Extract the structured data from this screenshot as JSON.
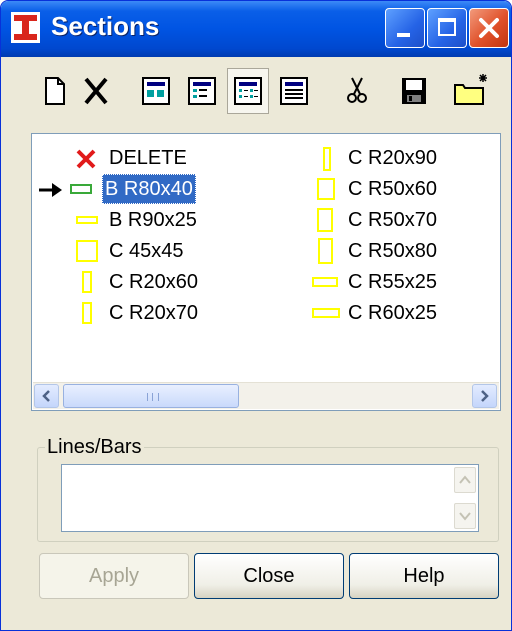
{
  "window": {
    "title": "Sections",
    "app_icon": "i-beam-section-icon",
    "controls": [
      "minimize-icon",
      "maximize-icon",
      "close-icon"
    ]
  },
  "toolbar": {
    "buttons": [
      {
        "name": "new-section",
        "icon": "new-document-icon"
      },
      {
        "name": "delete-section",
        "icon": "delete-x-icon"
      },
      {
        "name": "view-large-icons",
        "icon": "large-icons-view-icon"
      },
      {
        "name": "view-small-icons",
        "icon": "small-icons-view-icon"
      },
      {
        "name": "view-list",
        "icon": "list-view-icon",
        "pressed": true
      },
      {
        "name": "view-details",
        "icon": "details-view-icon"
      },
      {
        "name": "cut",
        "icon": "scissors-icon"
      },
      {
        "name": "save",
        "icon": "floppy-disk-icon"
      },
      {
        "name": "new-folder",
        "icon": "new-folder-icon"
      }
    ]
  },
  "sections": {
    "columns": [
      [
        {
          "label": "DELETE",
          "icon": "delete-x-icon"
        },
        {
          "label": "B R80x40",
          "icon": "rect-section-icon",
          "selected": true,
          "current": true
        },
        {
          "label": "B R90x25",
          "icon": "rect-section-icon"
        },
        {
          "label": "C 45x45",
          "icon": "square-section-icon"
        },
        {
          "label": "C R20x60",
          "icon": "rect-section-icon"
        },
        {
          "label": "C R20x70",
          "icon": "rect-section-icon"
        }
      ],
      [
        {
          "label": "C R20x90",
          "icon": "rect-section-icon"
        },
        {
          "label": "C R50x60",
          "icon": "rect-section-icon"
        },
        {
          "label": "C R50x70",
          "icon": "rect-section-icon"
        },
        {
          "label": "C R50x80",
          "icon": "rect-section-icon"
        },
        {
          "label": "C R55x25",
          "icon": "rect-section-icon"
        },
        {
          "label": "C R60x25",
          "icon": "rect-section-icon"
        }
      ]
    ],
    "scrollbar": {
      "left_icon": "chevron-left-icon",
      "right_icon": "chevron-right-icon",
      "grip": "III"
    }
  },
  "lines_bars": {
    "label": "Lines/Bars",
    "items": []
  },
  "buttons": {
    "apply": "Apply",
    "close": "Close",
    "help": "Help"
  },
  "colors": {
    "title_blue": "#0054e3",
    "section_yellow": "#ffff00",
    "section_green": "#39a939",
    "selection": "#316ac5"
  }
}
